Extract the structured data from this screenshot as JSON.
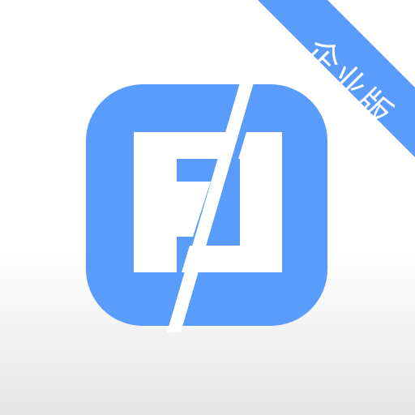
{
  "badge": {
    "label": "企业版",
    "color": "#599cfb",
    "text_color": "#ffffff"
  },
  "logo": {
    "name": "app-logo",
    "color": "#599cfb",
    "inner_color": "#ffffff"
  },
  "background": {
    "top_color": "#ffffff",
    "bottom_color": "#e6e6e6"
  }
}
